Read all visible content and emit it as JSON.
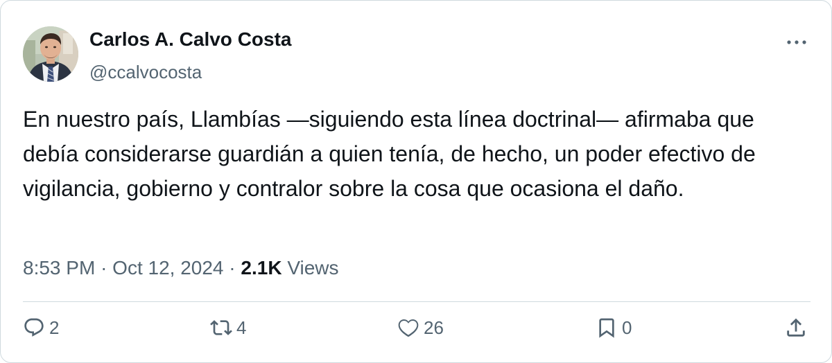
{
  "author": {
    "name": "Carlos A. Calvo Costa",
    "handle": "@ccalvocosta"
  },
  "tweet": {
    "text": "En nuestro país, Llambías —siguiendo esta línea doctrinal— afirmaba que debía considerarse guardián a quien tenía, de hecho, un poder efectivo de vigilancia, gobierno y contralor sobre la cosa que ocasiona el daño.",
    "time": "8:53 PM",
    "date": "Oct 12, 2024",
    "separator": "·",
    "views_count": "2.1K",
    "views_label": "Views"
  },
  "actions": {
    "replies": "2",
    "reposts": "4",
    "likes": "26",
    "bookmarks": "0"
  },
  "icons": {
    "reply": "reply-icon",
    "repost": "repost-icon",
    "like": "heart-icon",
    "bookmark": "bookmark-icon",
    "share": "share-icon",
    "more": "more-icon"
  },
  "colors": {
    "text": "#0f1419",
    "secondary": "#536471",
    "border": "#cfd9de"
  }
}
